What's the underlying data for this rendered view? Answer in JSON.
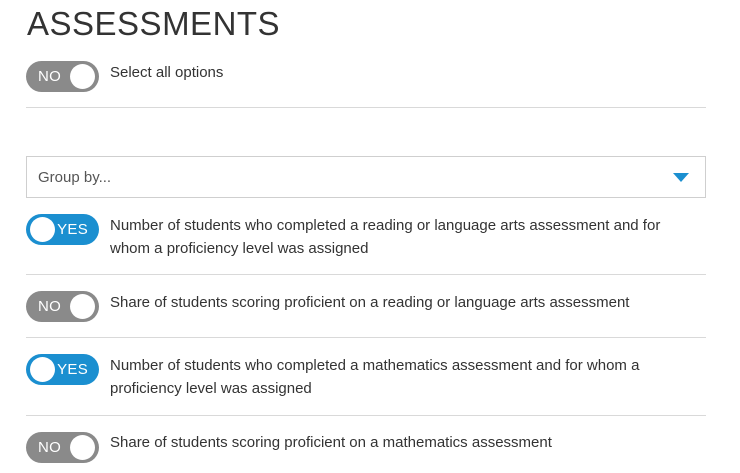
{
  "page_title": "ASSESSMENTS",
  "select_all": {
    "state": "NO",
    "label": "Select all options"
  },
  "group_by": {
    "placeholder": "Group by..."
  },
  "options": [
    {
      "state": "YES",
      "label_line1": "Number of students who completed a reading or language arts assessment and for",
      "label_line2": "whom a proficiency level was assigned"
    },
    {
      "state": "NO",
      "label_line1": "Share of students scoring proficient on a reading or language arts assessment"
    },
    {
      "state": "YES",
      "label_line1": "Number of students who completed a mathematics assessment and for whom a",
      "label_line2": "proficiency level was assigned"
    },
    {
      "state": "NO",
      "label_line1": "Share of students scoring proficient on a mathematics assessment"
    }
  ],
  "colors": {
    "toggle_on": "#1b8fd0",
    "toggle_off": "#8a8a8a",
    "divider": "#d9d9d9",
    "caret": "#1b8fd0"
  },
  "icons": {
    "dropdown": "caret-down-icon"
  }
}
